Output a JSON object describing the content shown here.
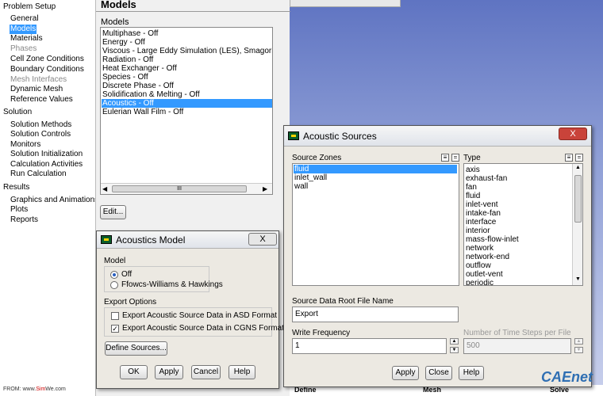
{
  "tree": {
    "problem_setup": "Problem Setup",
    "general": "General",
    "models": "Models",
    "materials": "Materials",
    "phases": "Phases",
    "cell_zone_conditions": "Cell Zone Conditions",
    "boundary_conditions": "Boundary Conditions",
    "mesh_interfaces": "Mesh Interfaces",
    "dynamic_mesh": "Dynamic Mesh",
    "reference_values": "Reference Values",
    "solution": "Solution",
    "solution_methods": "Solution Methods",
    "solution_controls": "Solution Controls",
    "monitors": "Monitors",
    "solution_initialization": "Solution Initialization",
    "calculation_activities": "Calculation Activities",
    "run_calculation": "Run Calculation",
    "results": "Results",
    "graphics_and_animations": "Graphics and Animations",
    "plots": "Plots",
    "reports": "Reports"
  },
  "footer": {
    "prefix": "FROM: www.",
    "site_red": "Sim",
    "site_rest": "We.com"
  },
  "models_panel": {
    "title": "Models",
    "list_label": "Models",
    "items": [
      "Multiphase - Off",
      "Energy - Off",
      "Viscous - Large Eddy Simulation (LES), Smagorinsky-L",
      "Radiation - Off",
      "Heat Exchanger - Off",
      "Species - Off",
      "Discrete Phase - Off",
      "Solidification & Melting - Off",
      "Acoustics - Off",
      "Eulerian Wall Film - Off"
    ],
    "selected_index": 8,
    "hscroll_grip": "III",
    "edit_button": "Edit..."
  },
  "acoustics_model": {
    "title": "Acoustics Model",
    "close": "X",
    "model_group": "Model",
    "off": "Off",
    "ffowcs": "Ffowcs-Williams & Hawkings",
    "export_group": "Export Options",
    "export_asd": "Export Acoustic Source Data in ASD Format",
    "export_cgns": "Export Acoustic Source Data in CGNS Format",
    "define_sources": "Define Sources...",
    "ok": "OK",
    "apply": "Apply",
    "cancel": "Cancel",
    "help": "Help"
  },
  "acoustic_sources": {
    "title": "Acoustic Sources",
    "close": "X",
    "source_zones_label": "Source Zones",
    "source_zones": [
      "fluid",
      "inlet_wall",
      "wall"
    ],
    "type_label": "Type",
    "types": [
      "axis",
      "exhaust-fan",
      "fan",
      "fluid",
      "inlet-vent",
      "intake-fan",
      "interface",
      "interior",
      "mass-flow-inlet",
      "network",
      "network-end",
      "outflow",
      "outlet-vent",
      "periodic"
    ],
    "root_file_label": "Source Data Root File Name",
    "root_file_value": "Export",
    "write_freq_label": "Write Frequency",
    "write_freq_value": "1",
    "time_steps_label": "Number of Time Steps per File",
    "time_steps_value": "500",
    "apply": "Apply",
    "close_btn": "Close",
    "help": "Help"
  },
  "graphics_footer": {
    "col1": "Define",
    "col2": "Mesh",
    "col3": "Solve"
  },
  "watermark": "CAEnet",
  "colors": {
    "selection": "#3399ff",
    "graphics_top": "#5f74c2",
    "close_red": "#c9433a"
  }
}
